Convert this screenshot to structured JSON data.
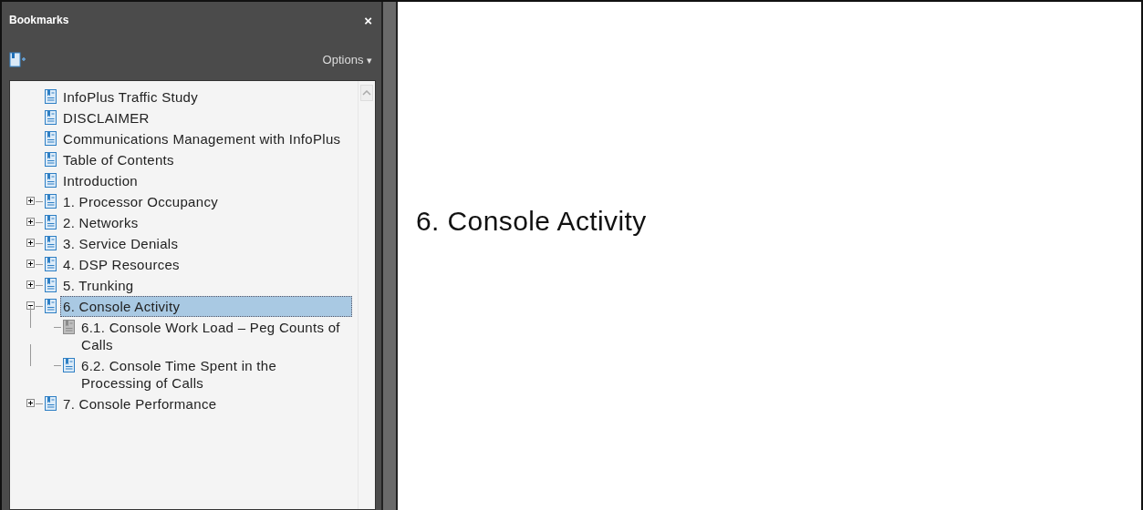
{
  "panel": {
    "title": "Bookmarks",
    "close": "×",
    "options": "Options",
    "options_caret": "▾"
  },
  "bookmarks": [
    {
      "label": "InfoPlus Traffic Study",
      "kind": "bookmark",
      "selected": false
    },
    {
      "label": "DISCLAIMER",
      "kind": "bookmark",
      "selected": false
    },
    {
      "label": "Communications Management with InfoPlus",
      "kind": "bookmark",
      "selected": false
    },
    {
      "label": "Table of Contents",
      "kind": "bookmark",
      "selected": false
    },
    {
      "label": "Introduction",
      "kind": "bookmark",
      "selected": false
    },
    {
      "label": "1. Processor Occupancy",
      "kind": "bookmark",
      "selected": false,
      "expanded": false
    },
    {
      "label": "2. Networks",
      "kind": "bookmark",
      "selected": false,
      "expanded": false
    },
    {
      "label": "3. Service Denials",
      "kind": "bookmark",
      "selected": false,
      "expanded": false
    },
    {
      "label": "4. DSP Resources",
      "kind": "bookmark",
      "selected": false,
      "expanded": false
    },
    {
      "label": "5. Trunking",
      "kind": "bookmark",
      "selected": false,
      "expanded": false
    },
    {
      "label": "6. Console Activity",
      "kind": "bookmark",
      "selected": true,
      "expanded": true,
      "children": [
        {
          "label": "6.1. Console Work Load – Peg Counts of Calls",
          "kind": "gray-bookmark",
          "selected": false
        },
        {
          "label": "6.2. Console Time Spent in the Processing of Calls",
          "kind": "bookmark",
          "selected": false
        }
      ]
    },
    {
      "label": "7. Console Performance",
      "kind": "bookmark",
      "selected": false,
      "expanded": false
    }
  ],
  "page": {
    "heading": "6. Console Activity"
  }
}
